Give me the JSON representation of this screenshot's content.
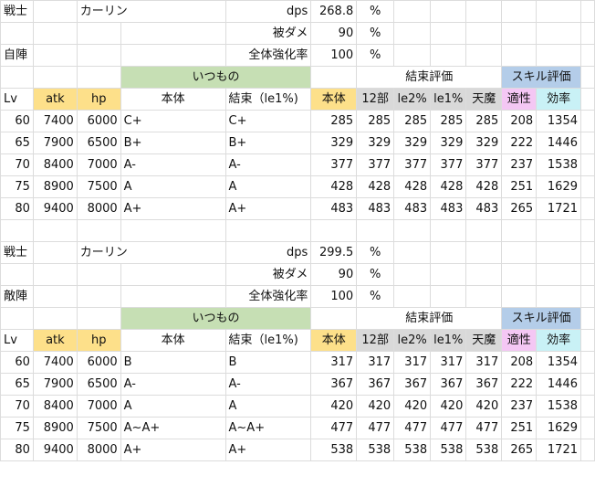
{
  "sections": [
    {
      "job": "戦士",
      "name": "カーリン",
      "formation": "自陣",
      "params": [
        {
          "label": "dps",
          "value": "268.8",
          "unit": "%"
        },
        {
          "label": "被ダメ",
          "value": "90",
          "unit": "%"
        },
        {
          "label": "全体強化率",
          "value": "100",
          "unit": "%"
        }
      ],
      "group_headers": {
        "itsumono": "いつもの",
        "kessoku": "結束評価",
        "skill": "スキル評価"
      },
      "columns": [
        "Lv",
        "atk",
        "hp",
        "本体",
        "結束（le1%)",
        "本体",
        "12部",
        "le2%",
        "le1%",
        "天魔",
        "適性",
        "効率"
      ],
      "rows": [
        [
          "60",
          "7400",
          "6000",
          "C+",
          "C+",
          "285",
          "285",
          "285",
          "285",
          "285",
          "208",
          "1354"
        ],
        [
          "65",
          "7900",
          "6500",
          "B+",
          "B+",
          "329",
          "329",
          "329",
          "329",
          "329",
          "222",
          "1446"
        ],
        [
          "70",
          "8400",
          "7000",
          "A-",
          "A-",
          "377",
          "377",
          "377",
          "377",
          "377",
          "237",
          "1538"
        ],
        [
          "75",
          "8900",
          "7500",
          "A",
          "A",
          "428",
          "428",
          "428",
          "428",
          "428",
          "251",
          "1629"
        ],
        [
          "80",
          "9400",
          "8000",
          "A+",
          "A+",
          "483",
          "483",
          "483",
          "483",
          "483",
          "265",
          "1721"
        ]
      ]
    },
    {
      "job": "戦士",
      "name": "カーリン",
      "formation": "敵陣",
      "params": [
        {
          "label": "dps",
          "value": "299.5",
          "unit": "%"
        },
        {
          "label": "被ダメ",
          "value": "90",
          "unit": "%"
        },
        {
          "label": "全体強化率",
          "value": "100",
          "unit": "%"
        }
      ],
      "group_headers": {
        "itsumono": "いつもの",
        "kessoku": "結束評価",
        "skill": "スキル評価"
      },
      "columns": [
        "Lv",
        "atk",
        "hp",
        "本体",
        "結束（le1%)",
        "本体",
        "12部",
        "le2%",
        "le1%",
        "天魔",
        "適性",
        "効率"
      ],
      "rows": [
        [
          "60",
          "7400",
          "6000",
          "B",
          "B",
          "317",
          "317",
          "317",
          "317",
          "317",
          "208",
          "1354"
        ],
        [
          "65",
          "7900",
          "6500",
          "A-",
          "A-",
          "367",
          "367",
          "367",
          "367",
          "367",
          "222",
          "1446"
        ],
        [
          "70",
          "8400",
          "7000",
          "A",
          "A",
          "420",
          "420",
          "420",
          "420",
          "420",
          "237",
          "1538"
        ],
        [
          "75",
          "8900",
          "7500",
          "A~A+",
          "A~A+",
          "477",
          "477",
          "477",
          "477",
          "477",
          "251",
          "1629"
        ],
        [
          "80",
          "9400",
          "8000",
          "A+",
          "A+",
          "538",
          "538",
          "538",
          "538",
          "538",
          "265",
          "1721"
        ]
      ]
    }
  ]
}
